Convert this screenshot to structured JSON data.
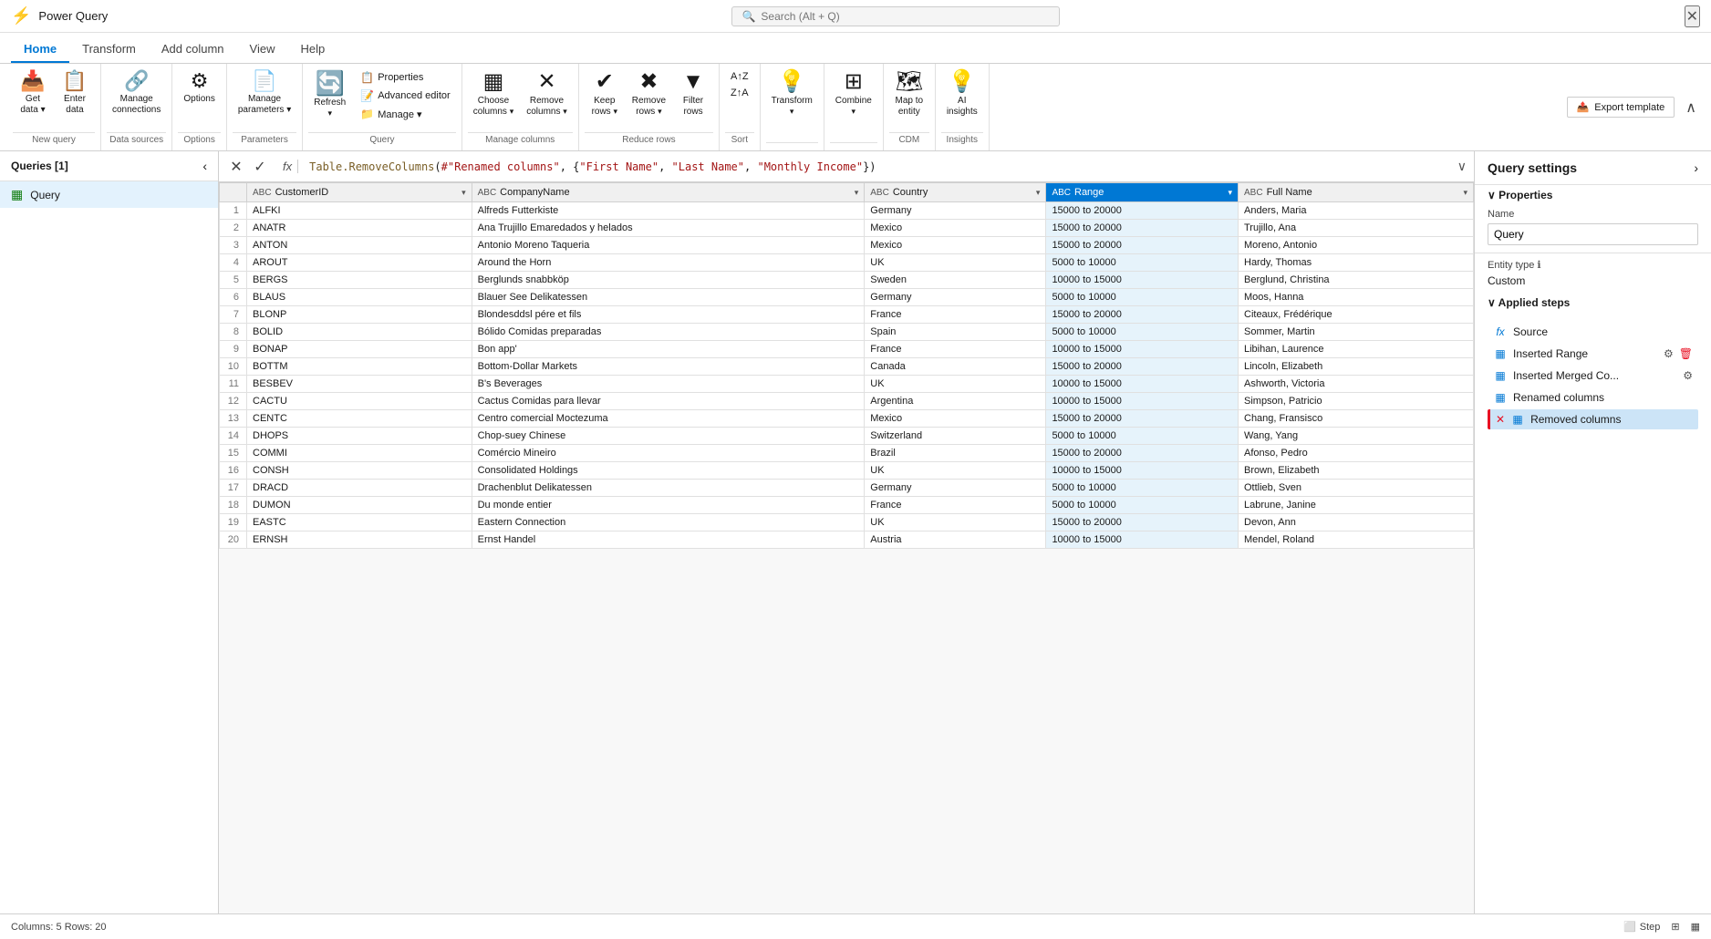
{
  "titleBar": {
    "title": "Power Query",
    "searchPlaceholder": "Search (Alt + Q)",
    "closeLabel": "✕"
  },
  "tabs": [
    {
      "label": "Home",
      "active": true
    },
    {
      "label": "Transform",
      "active": false
    },
    {
      "label": "Add column",
      "active": false
    },
    {
      "label": "View",
      "active": false
    },
    {
      "label": "Help",
      "active": false
    }
  ],
  "ribbon": {
    "groups": [
      {
        "label": "New query",
        "buttons": [
          {
            "id": "get-data",
            "icon": "📥",
            "label": "Get\ndata ▾"
          },
          {
            "id": "enter-data",
            "icon": "📋",
            "label": "Enter\ndata"
          }
        ]
      },
      {
        "label": "Data sources",
        "buttons": [
          {
            "id": "manage-connections",
            "icon": "🔗",
            "label": "Manage\nconnections"
          }
        ]
      },
      {
        "label": "Options",
        "buttons": [
          {
            "id": "options",
            "icon": "⚙",
            "label": "Options"
          }
        ]
      },
      {
        "label": "Parameters",
        "buttons": [
          {
            "id": "manage-parameters",
            "icon": "📄",
            "label": "Manage\nparameters ▾"
          }
        ]
      },
      {
        "label": "Query",
        "smButtons": [
          {
            "id": "properties",
            "icon": "📋",
            "label": "Properties"
          },
          {
            "id": "advanced-editor",
            "icon": "📝",
            "label": "Advanced editor"
          },
          {
            "id": "manage",
            "icon": "📁",
            "label": "Manage ▾"
          }
        ],
        "mainButton": {
          "id": "refresh",
          "icon": "🔄",
          "label": "Refresh\n▾"
        }
      },
      {
        "label": "Manage columns",
        "buttons": [
          {
            "id": "choose-columns",
            "icon": "▦",
            "label": "Choose\ncolumns ▾"
          },
          {
            "id": "remove-columns",
            "icon": "✕",
            "label": "Remove\ncolumns ▾"
          }
        ]
      },
      {
        "label": "Reduce rows",
        "buttons": [
          {
            "id": "keep-rows",
            "icon": "✔",
            "label": "Keep\nrows ▾"
          },
          {
            "id": "remove-rows",
            "icon": "✕",
            "label": "Remove\nrows ▾"
          },
          {
            "id": "filter-rows",
            "icon": "▼",
            "label": "Filter\nrows"
          }
        ]
      },
      {
        "label": "Sort",
        "buttons": [
          {
            "id": "sort-az",
            "icon": "↑",
            "label": "A↑Z"
          },
          {
            "id": "sort-za",
            "icon": "↓",
            "label": "Z↑A"
          }
        ]
      },
      {
        "label": "",
        "buttons": [
          {
            "id": "transform",
            "icon": "💡",
            "label": "Transform\n▾"
          }
        ]
      },
      {
        "label": "",
        "buttons": [
          {
            "id": "combine",
            "icon": "⊞",
            "label": "Combine\n▾"
          }
        ]
      },
      {
        "label": "CDM",
        "buttons": [
          {
            "id": "map-to-entity",
            "icon": "🗺",
            "label": "Map to\nentity"
          }
        ]
      },
      {
        "label": "Insights",
        "buttons": [
          {
            "id": "ai-insights",
            "icon": "💡",
            "label": "AI\ninsights"
          }
        ]
      }
    ],
    "exportTemplate": "Export template",
    "collapseLabel": "∧"
  },
  "queriesPanel": {
    "title": "Queries [1]",
    "items": [
      {
        "id": "query1",
        "label": "Query",
        "selected": true
      }
    ]
  },
  "formulaBar": {
    "cancelLabel": "✕",
    "acceptLabel": "✓",
    "fxLabel": "fx",
    "formula": "Table.RemoveColumns(#\"Renamed columns\", {\"First Name\", \"Last Name\", \"Monthly Income\"})",
    "expandLabel": "∨"
  },
  "table": {
    "columns": [
      {
        "id": "customerid",
        "type": "ABC",
        "label": "CustomerID",
        "selected": false
      },
      {
        "id": "companyname",
        "type": "ABC",
        "label": "CompanyName",
        "selected": false
      },
      {
        "id": "country",
        "type": "ABC",
        "label": "Country",
        "selected": false
      },
      {
        "id": "range",
        "type": "ABC",
        "label": "Range",
        "selected": true
      },
      {
        "id": "fullname",
        "type": "ABC",
        "label": "Full Name",
        "selected": false
      }
    ],
    "rows": [
      {
        "num": 1,
        "customerid": "ALFKI",
        "companyname": "Alfreds Futterkiste",
        "country": "Germany",
        "range": "15000 to 20000",
        "fullname": "Anders, Maria"
      },
      {
        "num": 2,
        "customerid": "ANATR",
        "companyname": "Ana Trujillo Emaredados y helados",
        "country": "Mexico",
        "range": "15000 to 20000",
        "fullname": "Trujillo, Ana"
      },
      {
        "num": 3,
        "customerid": "ANTON",
        "companyname": "Antonio Moreno Taqueria",
        "country": "Mexico",
        "range": "15000 to 20000",
        "fullname": "Moreno, Antonio"
      },
      {
        "num": 4,
        "customerid": "AROUT",
        "companyname": "Around the Horn",
        "country": "UK",
        "range": "5000 to 10000",
        "fullname": "Hardy, Thomas"
      },
      {
        "num": 5,
        "customerid": "BERGS",
        "companyname": "Berglunds snabbköp",
        "country": "Sweden",
        "range": "10000 to 15000",
        "fullname": "Berglund, Christina"
      },
      {
        "num": 6,
        "customerid": "BLAUS",
        "companyname": "Blauer See Delikatessen",
        "country": "Germany",
        "range": "5000 to 10000",
        "fullname": "Moos, Hanna"
      },
      {
        "num": 7,
        "customerid": "BLONP",
        "companyname": "Blondesddsl pére et fils",
        "country": "France",
        "range": "15000 to 20000",
        "fullname": "Citeaux, Frédérique"
      },
      {
        "num": 8,
        "customerid": "BOLID",
        "companyname": "Bólido Comidas preparadas",
        "country": "Spain",
        "range": "5000 to 10000",
        "fullname": "Sommer, Martin"
      },
      {
        "num": 9,
        "customerid": "BONAP",
        "companyname": "Bon app'",
        "country": "France",
        "range": "10000 to 15000",
        "fullname": "Libihan, Laurence"
      },
      {
        "num": 10,
        "customerid": "BOTTM",
        "companyname": "Bottom-Dollar Markets",
        "country": "Canada",
        "range": "15000 to 20000",
        "fullname": "Lincoln, Elizabeth"
      },
      {
        "num": 11,
        "customerid": "BESBEV",
        "companyname": "B's Beverages",
        "country": "UK",
        "range": "10000 to 15000",
        "fullname": "Ashworth, Victoria"
      },
      {
        "num": 12,
        "customerid": "CACTU",
        "companyname": "Cactus Comidas para llevar",
        "country": "Argentina",
        "range": "10000 to 15000",
        "fullname": "Simpson, Patricio"
      },
      {
        "num": 13,
        "customerid": "CENTC",
        "companyname": "Centro comercial Moctezuma",
        "country": "Mexico",
        "range": "15000 to 20000",
        "fullname": "Chang, Fransisco"
      },
      {
        "num": 14,
        "customerid": "DHOPS",
        "companyname": "Chop-suey Chinese",
        "country": "Switzerland",
        "range": "5000 to 10000",
        "fullname": "Wang, Yang"
      },
      {
        "num": 15,
        "customerid": "COMMI",
        "companyname": "Comércio Mineiro",
        "country": "Brazil",
        "range": "15000 to 20000",
        "fullname": "Afonso, Pedro"
      },
      {
        "num": 16,
        "customerid": "CONSH",
        "companyname": "Consolidated Holdings",
        "country": "UK",
        "range": "10000 to 15000",
        "fullname": "Brown, Elizabeth"
      },
      {
        "num": 17,
        "customerid": "DRACD",
        "companyname": "Drachenblut Delikatessen",
        "country": "Germany",
        "range": "5000 to 10000",
        "fullname": "Ottlieb, Sven"
      },
      {
        "num": 18,
        "customerid": "DUMON",
        "companyname": "Du monde entier",
        "country": "France",
        "range": "5000 to 10000",
        "fullname": "Labrune, Janine"
      },
      {
        "num": 19,
        "customerid": "EASTC",
        "companyname": "Eastern Connection",
        "country": "UK",
        "range": "15000 to 20000",
        "fullname": "Devon, Ann"
      },
      {
        "num": 20,
        "customerid": "ERNSH",
        "companyname": "Ernst Handel",
        "country": "Austria",
        "range": "10000 to 15000",
        "fullname": "Mendel, Roland"
      }
    ]
  },
  "querySettings": {
    "title": "Query settings",
    "propertiesLabel": "Properties",
    "nameLabel": "Name",
    "nameValue": "Query",
    "entityTypeLabel": "Entity type",
    "entityTypeHelp": "ℹ",
    "entityTypeValue": "Custom",
    "appliedStepsLabel": "Applied steps",
    "steps": [
      {
        "id": "source",
        "label": "Source",
        "icon": "fx",
        "hasGear": false,
        "hasDelete": false,
        "active": false,
        "hasError": false
      },
      {
        "id": "inserted-range",
        "label": "Inserted Range",
        "icon": "⊞",
        "hasGear": true,
        "hasDelete": true,
        "active": false,
        "hasError": false
      },
      {
        "id": "inserted-merged",
        "label": "Inserted Merged Co...",
        "icon": "⊞",
        "hasGear": true,
        "hasDelete": false,
        "active": false,
        "hasError": false
      },
      {
        "id": "renamed-columns",
        "label": "Renamed columns",
        "icon": "⊞",
        "hasGear": false,
        "hasDelete": false,
        "active": false,
        "hasError": false
      },
      {
        "id": "removed-columns",
        "label": "Removed columns",
        "icon": "⊟",
        "hasGear": false,
        "hasDelete": false,
        "active": true,
        "hasError": true
      }
    ]
  },
  "statusBar": {
    "info": "Columns: 5   Rows: 20",
    "stepLabel": "Step",
    "diagramLabel": "⊞",
    "tableLabel": "▦"
  }
}
